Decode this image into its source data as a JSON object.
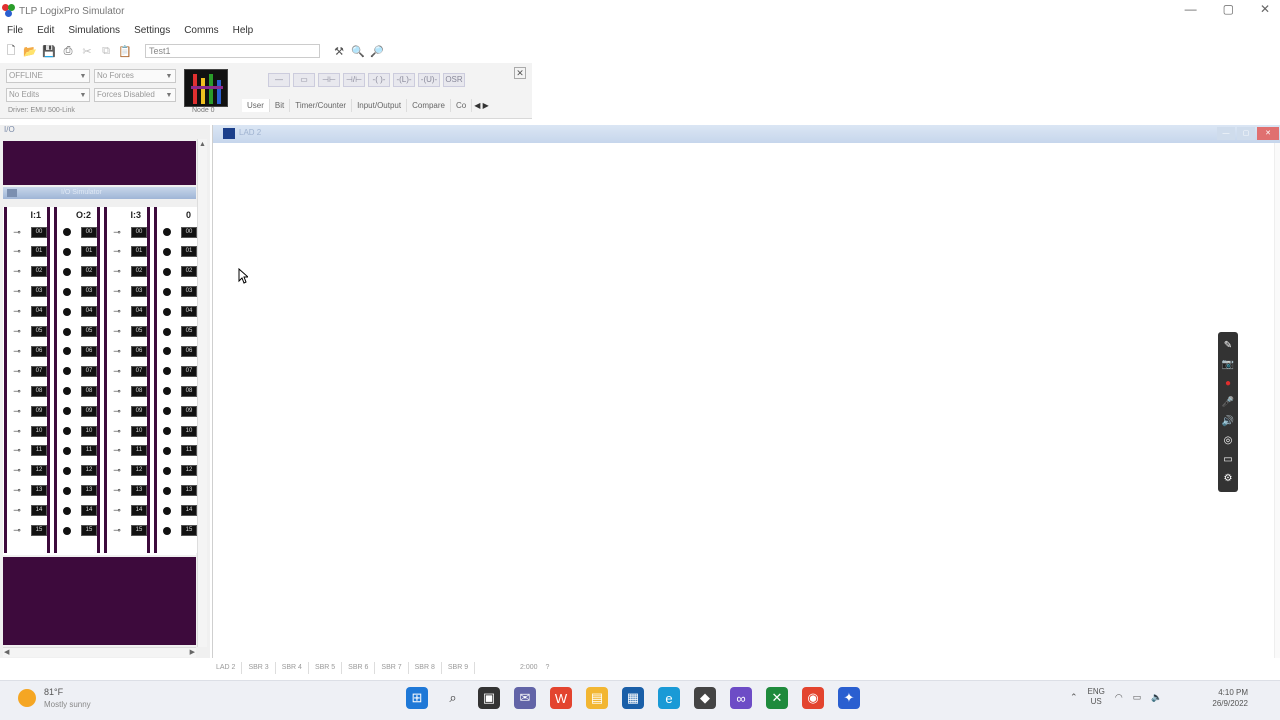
{
  "window": {
    "title": "TLP LogixPro Simulator",
    "controls": [
      "—",
      "▢",
      "✕"
    ]
  },
  "menu": [
    "File",
    "Edit",
    "Simulations",
    "Settings",
    "Comms",
    "Help"
  ],
  "toolbar": {
    "file_field": "Test1"
  },
  "ribbon": {
    "mode_select": "OFFLINE",
    "forces_select": "No Forces",
    "edits_select": "No Edits",
    "forces_state_select": "Forces Disabled",
    "driver_text": "Driver: EMU 500-Link",
    "logo_caption": "Node 0",
    "close": "✕",
    "instruction_labels": [
      "—",
      "▭",
      "⊣⊢",
      "⊣/⊢",
      "-( )-",
      "-(L)-",
      "-(U)-",
      "OSR"
    ],
    "tabs": [
      "User",
      "Bit",
      "Timer/Counter",
      "Input/Output",
      "Compare",
      "Co"
    ],
    "tab_arrows": "◀ ▶"
  },
  "io_panel": {
    "header": "I/O",
    "strip_label": "I/O Simulator",
    "modules": [
      {
        "label": "I:1",
        "kind": "input"
      },
      {
        "label": "O:2",
        "kind": "output"
      },
      {
        "label": "I:3",
        "kind": "input"
      },
      {
        "label": "0",
        "kind": "output"
      }
    ],
    "channels": [
      "00",
      "01",
      "02",
      "03",
      "04",
      "05",
      "06",
      "07",
      "08",
      "09",
      "10",
      "11",
      "12",
      "13",
      "14",
      "15"
    ],
    "switch_glyph": "⊸",
    "scroll_up": "▲",
    "scroll_left": "◀",
    "scroll_right": "▶"
  },
  "ladder": {
    "window_title": "LAD 2",
    "sheet_tabs": [
      "LAD 2",
      "SBR 3",
      "SBR 4",
      "SBR 5",
      "SBR 6",
      "SBR 7",
      "SBR 8",
      "SBR 9"
    ],
    "readout": [
      "2:000",
      "?"
    ]
  },
  "recorder": {
    "icons": [
      "✎",
      "📷",
      "●",
      "🎤",
      "🔊",
      "◎",
      "▭",
      "⚙"
    ]
  },
  "taskbar": {
    "weather_temp": "81°F",
    "weather_desc": "Mostly sunny",
    "apps": [
      "windows-start",
      "search",
      "file-manager",
      "chat",
      "office",
      "folder",
      "store",
      "edge",
      "app",
      "vs",
      "xbox",
      "chrome",
      "logixpro"
    ],
    "tray_lang_top": "ENG",
    "tray_lang_bottom": "US",
    "time": "4:10 PM",
    "date": "26/9/2022"
  },
  "colors": {
    "panel_purple": "#3d0a3c",
    "title_blue": "#c6d6ec"
  }
}
